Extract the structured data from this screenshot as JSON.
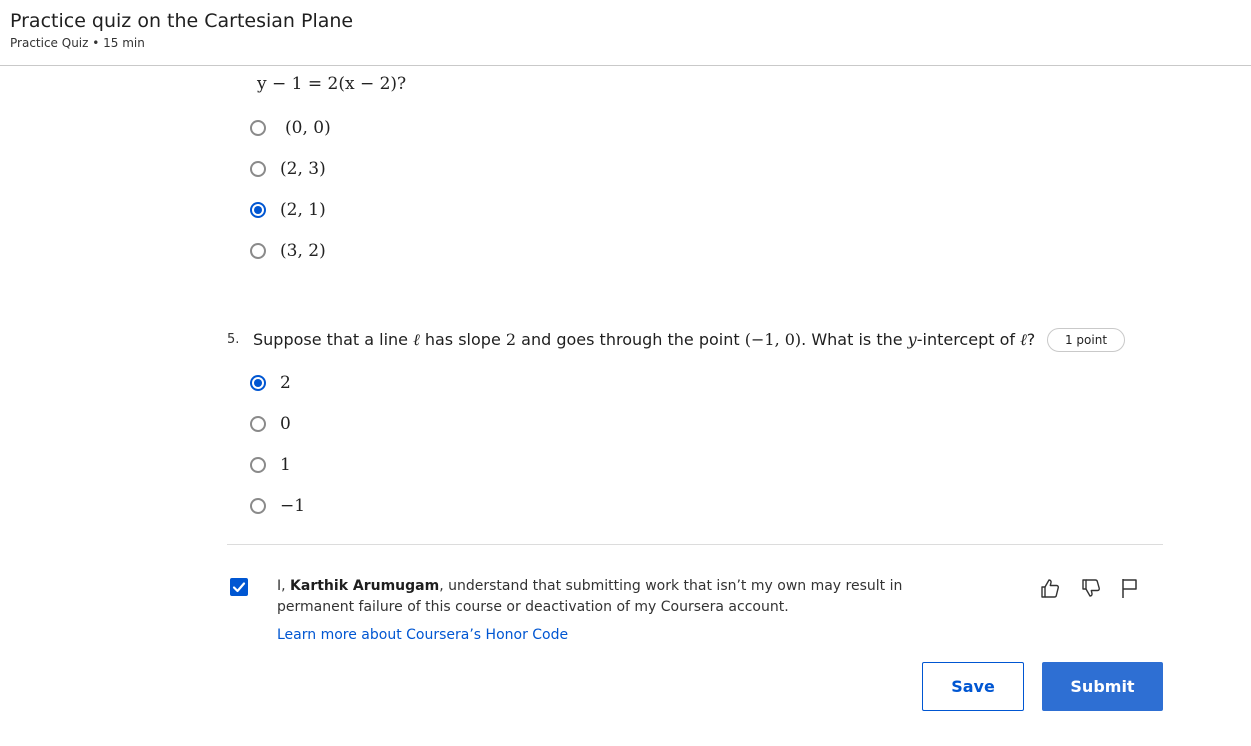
{
  "header": {
    "title": "Practice quiz on the Cartesian Plane",
    "meta": "Practice Quiz • 15 min"
  },
  "question4": {
    "tail": "y − 1 = 2(x − 2)?",
    "options": [
      {
        "label": "(0, 0)",
        "selected": false
      },
      {
        "label": "(2, 3)",
        "selected": false
      },
      {
        "label": "(2, 1)",
        "selected": true
      },
      {
        "label": "(3, 2)",
        "selected": false
      }
    ]
  },
  "question5": {
    "number": "5.",
    "text_part1": "Suppose that a line ",
    "ell1": "ℓ",
    "text_part2": " has slope ",
    "slope": "2",
    "text_part3": " and goes through the point ",
    "point": "(−1, 0)",
    "text_part4": ". What is the ",
    "yvar": "y",
    "text_part5": "-intercept of ",
    "ell2": "ℓ",
    "text_part6": "?",
    "points": "1 point",
    "options": [
      {
        "label": "2",
        "selected": true
      },
      {
        "label": "0",
        "selected": false
      },
      {
        "label": "1",
        "selected": false
      },
      {
        "label": "−1",
        "selected": false
      }
    ]
  },
  "honor": {
    "checked": true,
    "prefix": "I, ",
    "name": "Karthik Arumugam",
    "statement": ", understand that submitting work that isn’t my own may result in permanent failure of this course or deactivation of my Coursera account.",
    "link": "Learn more about Coursera’s Honor Code"
  },
  "icons": {
    "like": "thumbs-up-icon",
    "dislike": "thumbs-down-icon",
    "flag": "flag-icon"
  },
  "buttons": {
    "save": "Save",
    "submit": "Submit"
  },
  "colors": {
    "accent": "#0056d2",
    "submit_bg": "#2e6fd3"
  }
}
